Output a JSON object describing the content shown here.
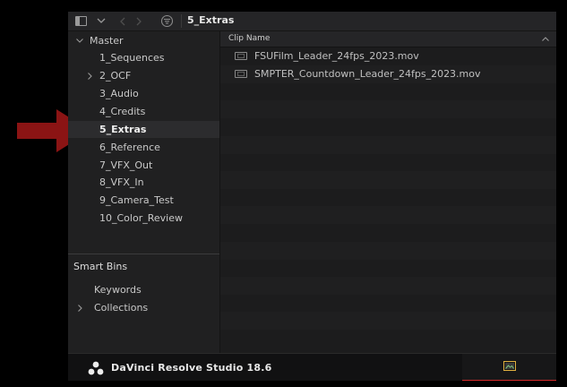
{
  "toolbar": {
    "current_bin": "5_Extras"
  },
  "bins": {
    "root_label": "Master",
    "items": [
      {
        "label": "1_Sequences",
        "has_children": false,
        "selected": false
      },
      {
        "label": "2_OCF",
        "has_children": true,
        "selected": false
      },
      {
        "label": "3_Audio",
        "has_children": false,
        "selected": false
      },
      {
        "label": "4_Credits",
        "has_children": false,
        "selected": false
      },
      {
        "label": "5_Extras",
        "has_children": false,
        "selected": true
      },
      {
        "label": "6_Reference",
        "has_children": false,
        "selected": false
      },
      {
        "label": "7_VFX_Out",
        "has_children": false,
        "selected": false
      },
      {
        "label": "8_VFX_In",
        "has_children": false,
        "selected": false
      },
      {
        "label": "9_Camera_Test",
        "has_children": false,
        "selected": false
      },
      {
        "label": "10_Color_Review",
        "has_children": false,
        "selected": false
      }
    ],
    "smart_bins_title": "Smart Bins",
    "smart_items": [
      {
        "label": "Keywords",
        "has_children": false
      },
      {
        "label": "Collections",
        "has_children": true
      }
    ]
  },
  "clip_list": {
    "column_header": "Clip Name",
    "clips": [
      {
        "name": "FSUFilm_Leader_24fps_2023.mov"
      },
      {
        "name": "SMPTER_Countdown_Leader_24fps_2023.mov"
      }
    ]
  },
  "footer": {
    "app_name": "DaVinci Resolve Studio 18.6",
    "active_page_icon": "media-page-icon"
  },
  "colors": {
    "annotation_arrow": "#8b1414",
    "active_tab_bar": "#d22a2a",
    "selected_row": "#2c2c2e"
  }
}
